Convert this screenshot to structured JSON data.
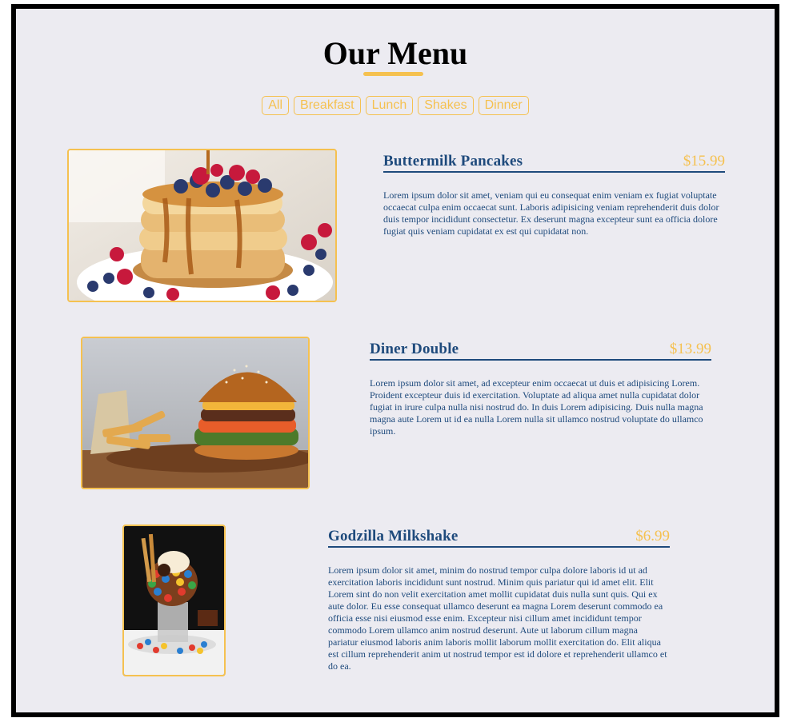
{
  "header": {
    "title": "Our Menu"
  },
  "filters": [
    "All",
    "Breakfast",
    "Lunch",
    "Shakes",
    "Dinner"
  ],
  "colors": {
    "accent": "#f5c150",
    "text_blue": "#1e4a7c",
    "background": "#ecebf1",
    "frame": "#000000"
  },
  "items": [
    {
      "name": "Buttermilk Pancakes",
      "price": "$15.99",
      "desc": "Lorem ipsum dolor sit amet, veniam qui eu consequat enim veniam ex fugiat voluptate occaecat culpa enim occaecat sunt. Laboris adipisicing veniam reprehenderit duis dolor duis tempor incididunt consectetur. Ex deserunt magna excepteur sunt ea officia dolore fugiat quis veniam cupidatat ex est qui cupidatat non.",
      "image": "pancakes-photo"
    },
    {
      "name": "Diner Double",
      "price": "$13.99",
      "desc": "Lorem ipsum dolor sit amet, ad excepteur enim occaecat ut duis et adipisicing Lorem. Proident excepteur duis id exercitation. Voluptate ad aliqua amet nulla cupidatat dolor fugiat in irure culpa nulla nisi nostrud do. In duis Lorem adipisicing. Duis nulla magna magna aute Lorem ut id ea nulla Lorem nulla sit ullamco nostrud voluptate do ullamco ipsum.",
      "image": "burger-photo"
    },
    {
      "name": "Godzilla Milkshake",
      "price": "$6.99",
      "desc": "Lorem ipsum dolor sit amet, minim do nostrud tempor culpa dolore laboris id ut ad exercitation laboris incididunt sunt nostrud. Minim quis pariatur qui id amet elit. Elit Lorem sint do non velit exercitation amet mollit cupidatat duis nulla sunt quis. Qui ex aute dolor. Eu esse consequat ullamco deserunt ea magna Lorem deserunt commodo ea officia esse nisi eiusmod esse enim. Excepteur nisi cillum amet incididunt tempor commodo Lorem ullamco anim nostrud deserunt. Aute ut laborum cillum magna pariatur eiusmod laboris anim laboris mollit laborum mollit exercitation do. Elit aliqua est cillum reprehenderit anim ut nostrud tempor est id dolore et reprehenderit ullamco et do ea.",
      "image": "milkshake-photo"
    }
  ]
}
